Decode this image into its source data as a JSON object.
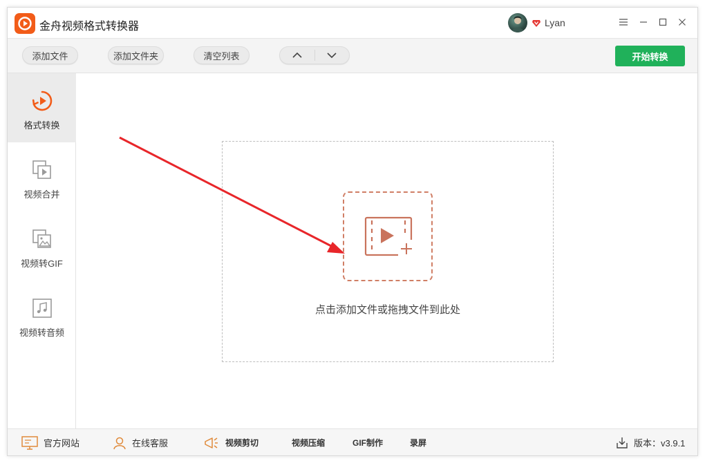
{
  "app": {
    "title": "金舟视频格式转换器",
    "username": "Lyan"
  },
  "toolbar": {
    "add_file": "添加文件",
    "add_folder": "添加文件夹",
    "clear_list": "清空列表",
    "start_convert": "开始转换"
  },
  "sidebar": {
    "items": [
      {
        "label": "格式转换",
        "icon": "format-convert-icon"
      },
      {
        "label": "视频合并",
        "icon": "video-merge-icon"
      },
      {
        "label": "视频转GIF",
        "icon": "video-to-gif-icon"
      },
      {
        "label": "视频转音频",
        "icon": "video-to-audio-icon"
      }
    ]
  },
  "main": {
    "drop_hint": "点击添加文件或拖拽文件到此处"
  },
  "statusbar": {
    "official_site": "官方网站",
    "online_support": "在线客服",
    "video_cut": "视频剪切",
    "video_compress": "视频压缩",
    "gif_make": "GIF制作",
    "screen_record": "录屏",
    "version": "版本：v3.9.1"
  },
  "colors": {
    "accent_orange": "#f25c19",
    "start_green": "#20b15a",
    "drop_accent": "#d07e65",
    "arrow_red": "#e8262a"
  }
}
